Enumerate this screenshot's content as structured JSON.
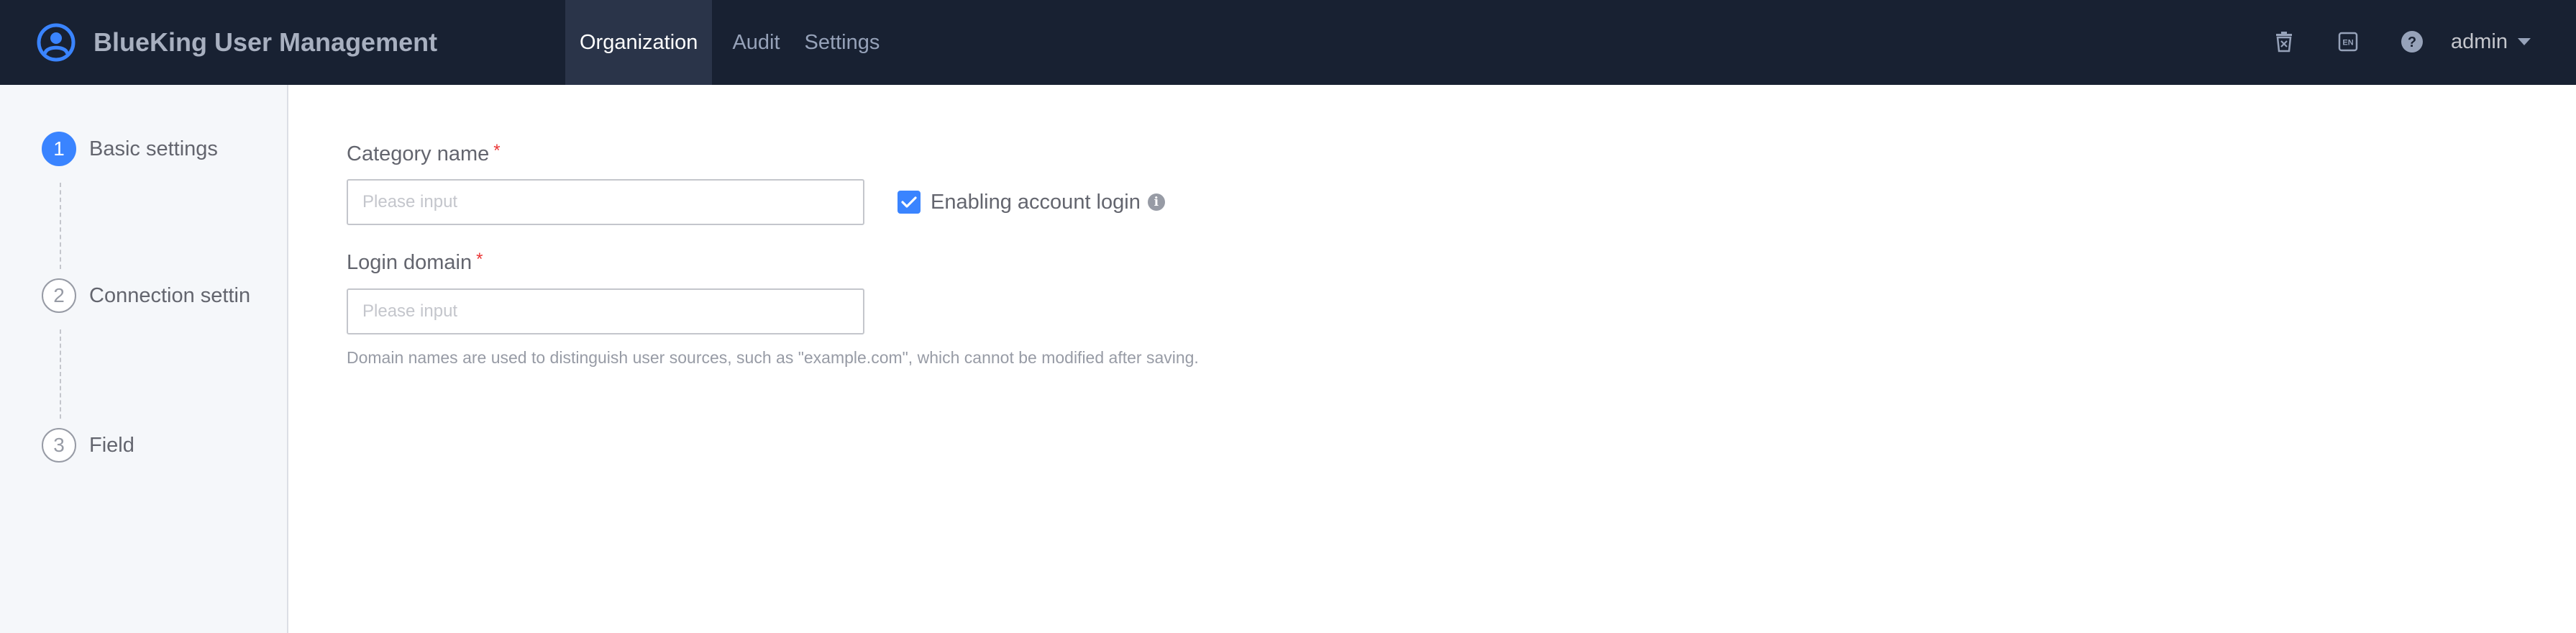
{
  "header": {
    "app_title": "BlueKing User Management",
    "logo_icon": "user-circle-logo-icon",
    "nav": [
      {
        "label": "Organization",
        "active": true
      },
      {
        "label": "Audit",
        "active": false
      },
      {
        "label": "Settings",
        "active": false
      }
    ],
    "icons": [
      "recycle-bin-icon",
      "language-switch-icon",
      "help-icon"
    ],
    "language_icon_text": "EN",
    "help_icon_text": "?",
    "user": "admin"
  },
  "steps": [
    {
      "number": "1",
      "label": "Basic settings",
      "state": "current"
    },
    {
      "number": "2",
      "label": "Connection settin",
      "state": "pending"
    },
    {
      "number": "3",
      "label": "Field",
      "state": "pending"
    }
  ],
  "form": {
    "category_name": {
      "label": "Category name",
      "required_mark": "*",
      "value": "",
      "placeholder": "Please input"
    },
    "enable_login": {
      "label": "Enabling account login",
      "checked": true,
      "info_icon": "info-icon",
      "info_icon_text": "i"
    },
    "login_domain": {
      "label": "Login domain",
      "required_mark": "*",
      "value": "",
      "placeholder": "Please input",
      "hint": "Domain names are used to distinguish user sources, such as \"example.com\", which cannot be modified after saving."
    }
  },
  "colors": {
    "header_bg": "#182132",
    "accent": "#3a84ff",
    "required": "#ea3636",
    "sidebar_bg": "#f5f7fa"
  }
}
